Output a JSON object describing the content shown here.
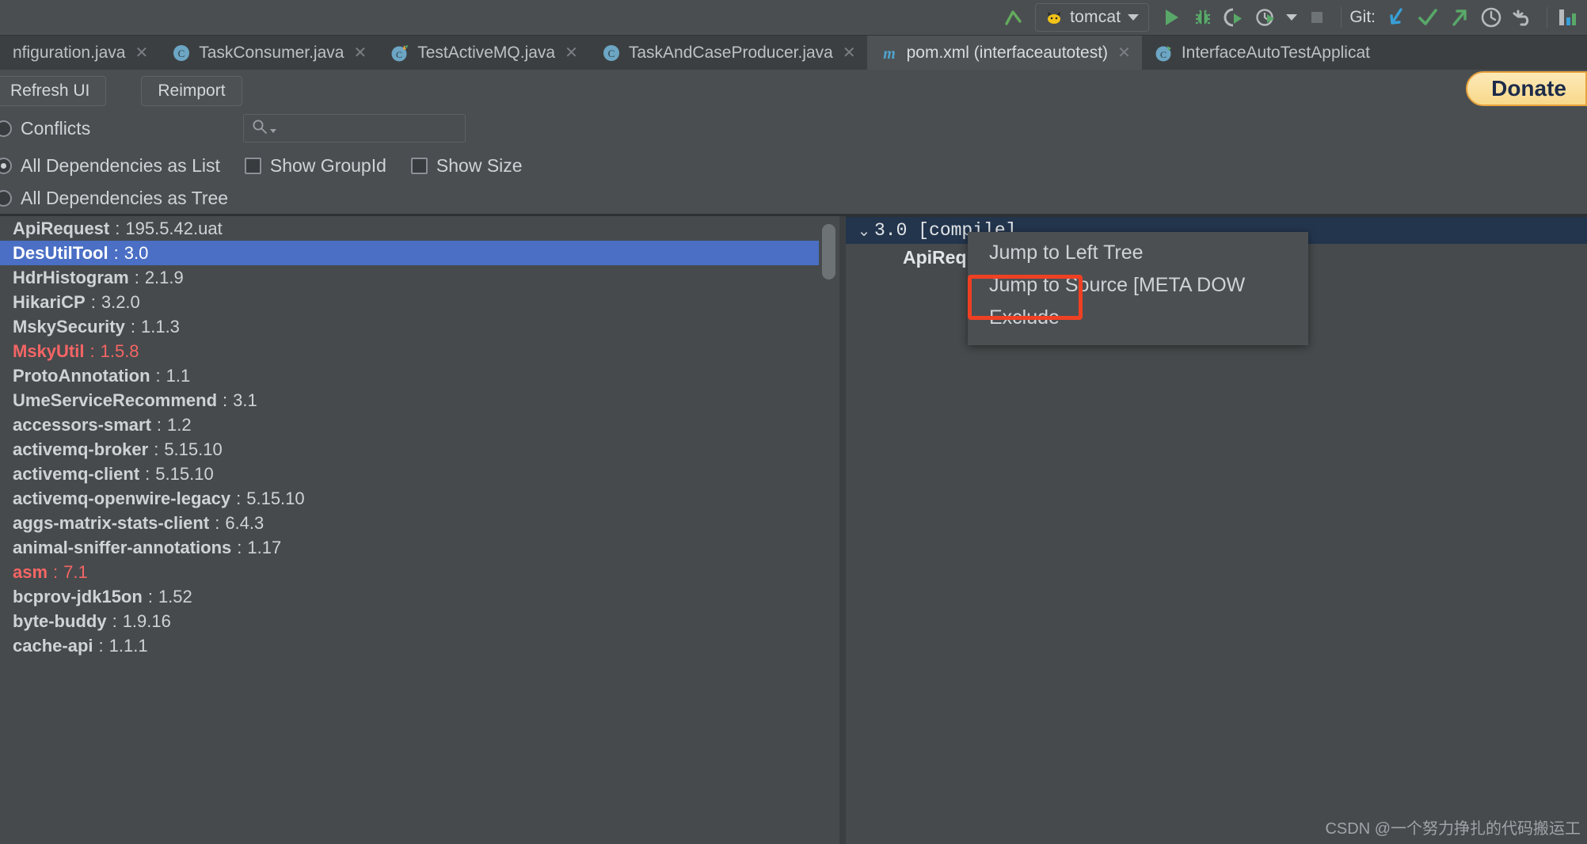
{
  "toolbar": {
    "up_icon": "arrow-up-icon",
    "run_config": {
      "label": "tomcat",
      "icon": "tomcat-cat-icon"
    },
    "run_icon": "run-icon",
    "debug_icon": "debug-bug-icon",
    "run_coverage_icon": "run-with-coverage-icon",
    "profile_icon": "profiler-icon",
    "stop_icon": "stop-icon",
    "git_label": "Git:",
    "git_update_icon": "update-project-icon",
    "git_commit_icon": "commit-checkmark-icon",
    "git_push_icon": "push-arrow-icon",
    "git_history_icon": "history-clock-icon",
    "git_rollback_icon": "rollback-undo-icon",
    "layout_icon": "tool-window-layout-icon"
  },
  "tabs": [
    {
      "title": "nfiguration.java",
      "icon": "java-class-icon",
      "active": false,
      "closable": true,
      "truncated_left": true
    },
    {
      "title": "TaskConsumer.java",
      "icon": "java-class-icon",
      "active": false,
      "closable": true
    },
    {
      "title": "TestActiveMQ.java",
      "icon": "java-test-class-icon",
      "active": false,
      "closable": true
    },
    {
      "title": "TaskAndCaseProducer.java",
      "icon": "java-class-icon",
      "active": false,
      "closable": true
    },
    {
      "title": "pom.xml (interfaceautotest)",
      "icon": "maven-m-icon",
      "active": true,
      "closable": true
    },
    {
      "title": "InterfaceAutoTestApplicat",
      "icon": "spring-boot-class-icon",
      "active": false,
      "closable": false
    }
  ],
  "maven_toolbar": {
    "refresh_label": "Refresh UI",
    "reimport_label": "Reimport",
    "donate_label": "Donate"
  },
  "filters": {
    "conflicts_label": "Conflicts",
    "conflicts_checked": false,
    "all_as_list_label": "All Dependencies as List",
    "all_as_list_checked": true,
    "all_as_tree_label": "All Dependencies as Tree",
    "all_as_tree_checked": false,
    "show_groupid_label": "Show GroupId",
    "show_groupid_checked": false,
    "show_size_label": "Show Size",
    "show_size_checked": false,
    "search_placeholder": "",
    "search_value": "",
    "search_icon": "search-magnifier-icon"
  },
  "dependencies": [
    {
      "name": "ApiRequest",
      "version": "195.5.42.uat",
      "state": "normal"
    },
    {
      "name": "DesUtilTool",
      "version": "3.0",
      "state": "selected"
    },
    {
      "name": "HdrHistogram",
      "version": "2.1.9",
      "state": "normal"
    },
    {
      "name": "HikariCP",
      "version": "3.2.0",
      "state": "normal"
    },
    {
      "name": "MskySecurity",
      "version": "1.1.3",
      "state": "normal"
    },
    {
      "name": "MskyUtil",
      "version": "1.5.8",
      "state": "warn"
    },
    {
      "name": "ProtoAnnotation",
      "version": "1.1",
      "state": "normal"
    },
    {
      "name": "UmeServiceRecommend",
      "version": "3.1",
      "state": "normal"
    },
    {
      "name": "accessors-smart",
      "version": "1.2",
      "state": "normal"
    },
    {
      "name": "activemq-broker",
      "version": "5.15.10",
      "state": "normal"
    },
    {
      "name": "activemq-client",
      "version": "5.15.10",
      "state": "normal"
    },
    {
      "name": "activemq-openwire-legacy",
      "version": "5.15.10",
      "state": "normal"
    },
    {
      "name": "aggs-matrix-stats-client",
      "version": "6.4.3",
      "state": "normal"
    },
    {
      "name": "animal-sniffer-annotations",
      "version": "1.17",
      "state": "normal"
    },
    {
      "name": "asm",
      "version": "7.1",
      "state": "warn"
    },
    {
      "name": "bcprov-jdk15on",
      "version": "1.52",
      "state": "normal"
    },
    {
      "name": "byte-buddy",
      "version": "1.9.16",
      "state": "normal"
    },
    {
      "name": "cache-api",
      "version": "1.1.1",
      "state": "normal"
    }
  ],
  "dependency_tree": {
    "root": {
      "label": "3.0 [compile]",
      "chevron": "chevron-down-icon",
      "selected": true
    },
    "child": {
      "label": "ApiReq"
    }
  },
  "context_menu": {
    "items": [
      {
        "label": "Jump to Left Tree",
        "highlighted": false
      },
      {
        "label": "Jump to Source [META DOW",
        "highlighted": false
      },
      {
        "label": "Exclude",
        "highlighted": true
      }
    ]
  },
  "watermark": "CSDN @一个努力挣扎的代码搬运工",
  "colors": {
    "accent_selection": "#4a6fc4",
    "tree_selection": "#23354d",
    "warn_text": "#f56565",
    "highlight_box": "#ef4023",
    "donate_border": "#e8a33d"
  }
}
